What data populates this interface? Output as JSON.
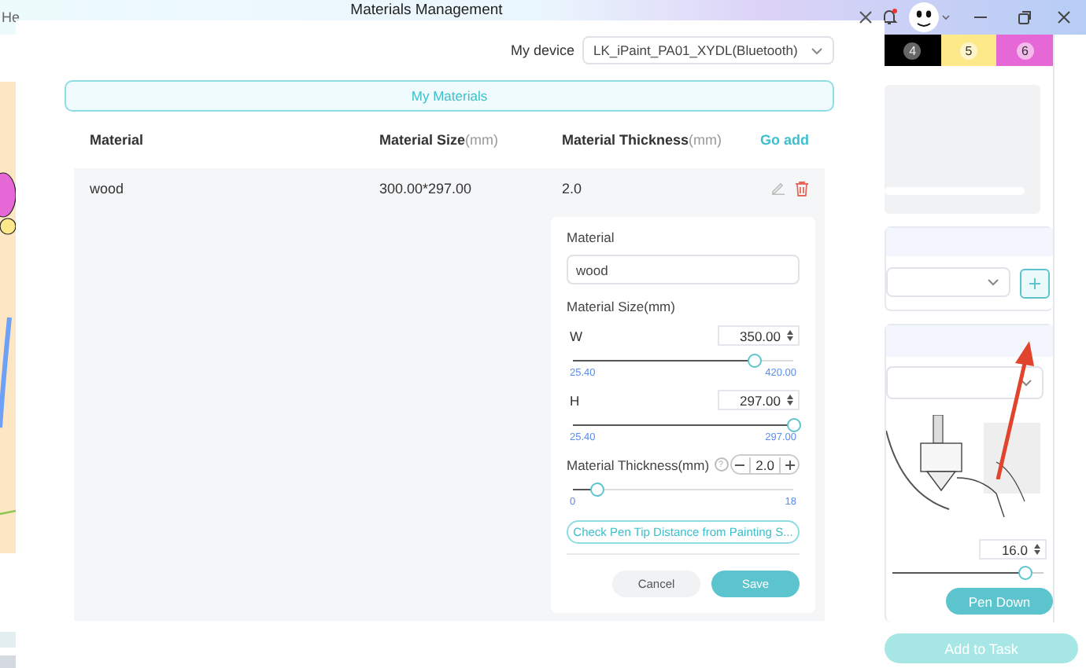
{
  "app": {
    "title_fragment": "He"
  },
  "side_panel": {
    "swatches": [
      {
        "label": "4",
        "color": "#000000"
      },
      {
        "label": "5",
        "color": "#fde98a"
      },
      {
        "label": "6",
        "color": "#e667d6"
      }
    ],
    "pen_height": {
      "value": "16.0",
      "level": 0.88
    },
    "pen_button": "Pen Down",
    "add_button": {
      "label": "Add to Task",
      "disabled": true
    }
  },
  "dialog": {
    "title": "Materials Management",
    "device_label": "My device",
    "device": "LK_iPaint_PA01_XYDL(Bluetooth)",
    "tabs": [
      {
        "label": "My Materials",
        "selected": true
      }
    ],
    "columns": [
      {
        "name": "Material"
      },
      {
        "name": "Material Size",
        "unit": "(mm)"
      },
      {
        "name": "Material Thickness",
        "unit": "(mm)"
      }
    ],
    "go_add": "Go add",
    "rows": [
      {
        "material": "wood",
        "size": "300.00*297.00",
        "thickness": "2.0"
      }
    ],
    "edit_form": {
      "material_label": "Material",
      "material_value": "wood",
      "size_label": "Material Size(mm)",
      "width": {
        "label": "W",
        "value": "350.00",
        "level": 0.82,
        "min": "25.40",
        "max": "420.00"
      },
      "height": {
        "label": "H",
        "value": "297.00",
        "level": 1,
        "min": "25.40",
        "max": "297.00"
      },
      "thickness": {
        "label": "Material Thickness(mm)",
        "help": "?",
        "value": "2.0",
        "level": 0.11,
        "min": "0",
        "max": "18"
      },
      "check_button": "Check Pen Tip Distance from Painting S...",
      "cancel": "Cancel",
      "save": "Save"
    }
  }
}
